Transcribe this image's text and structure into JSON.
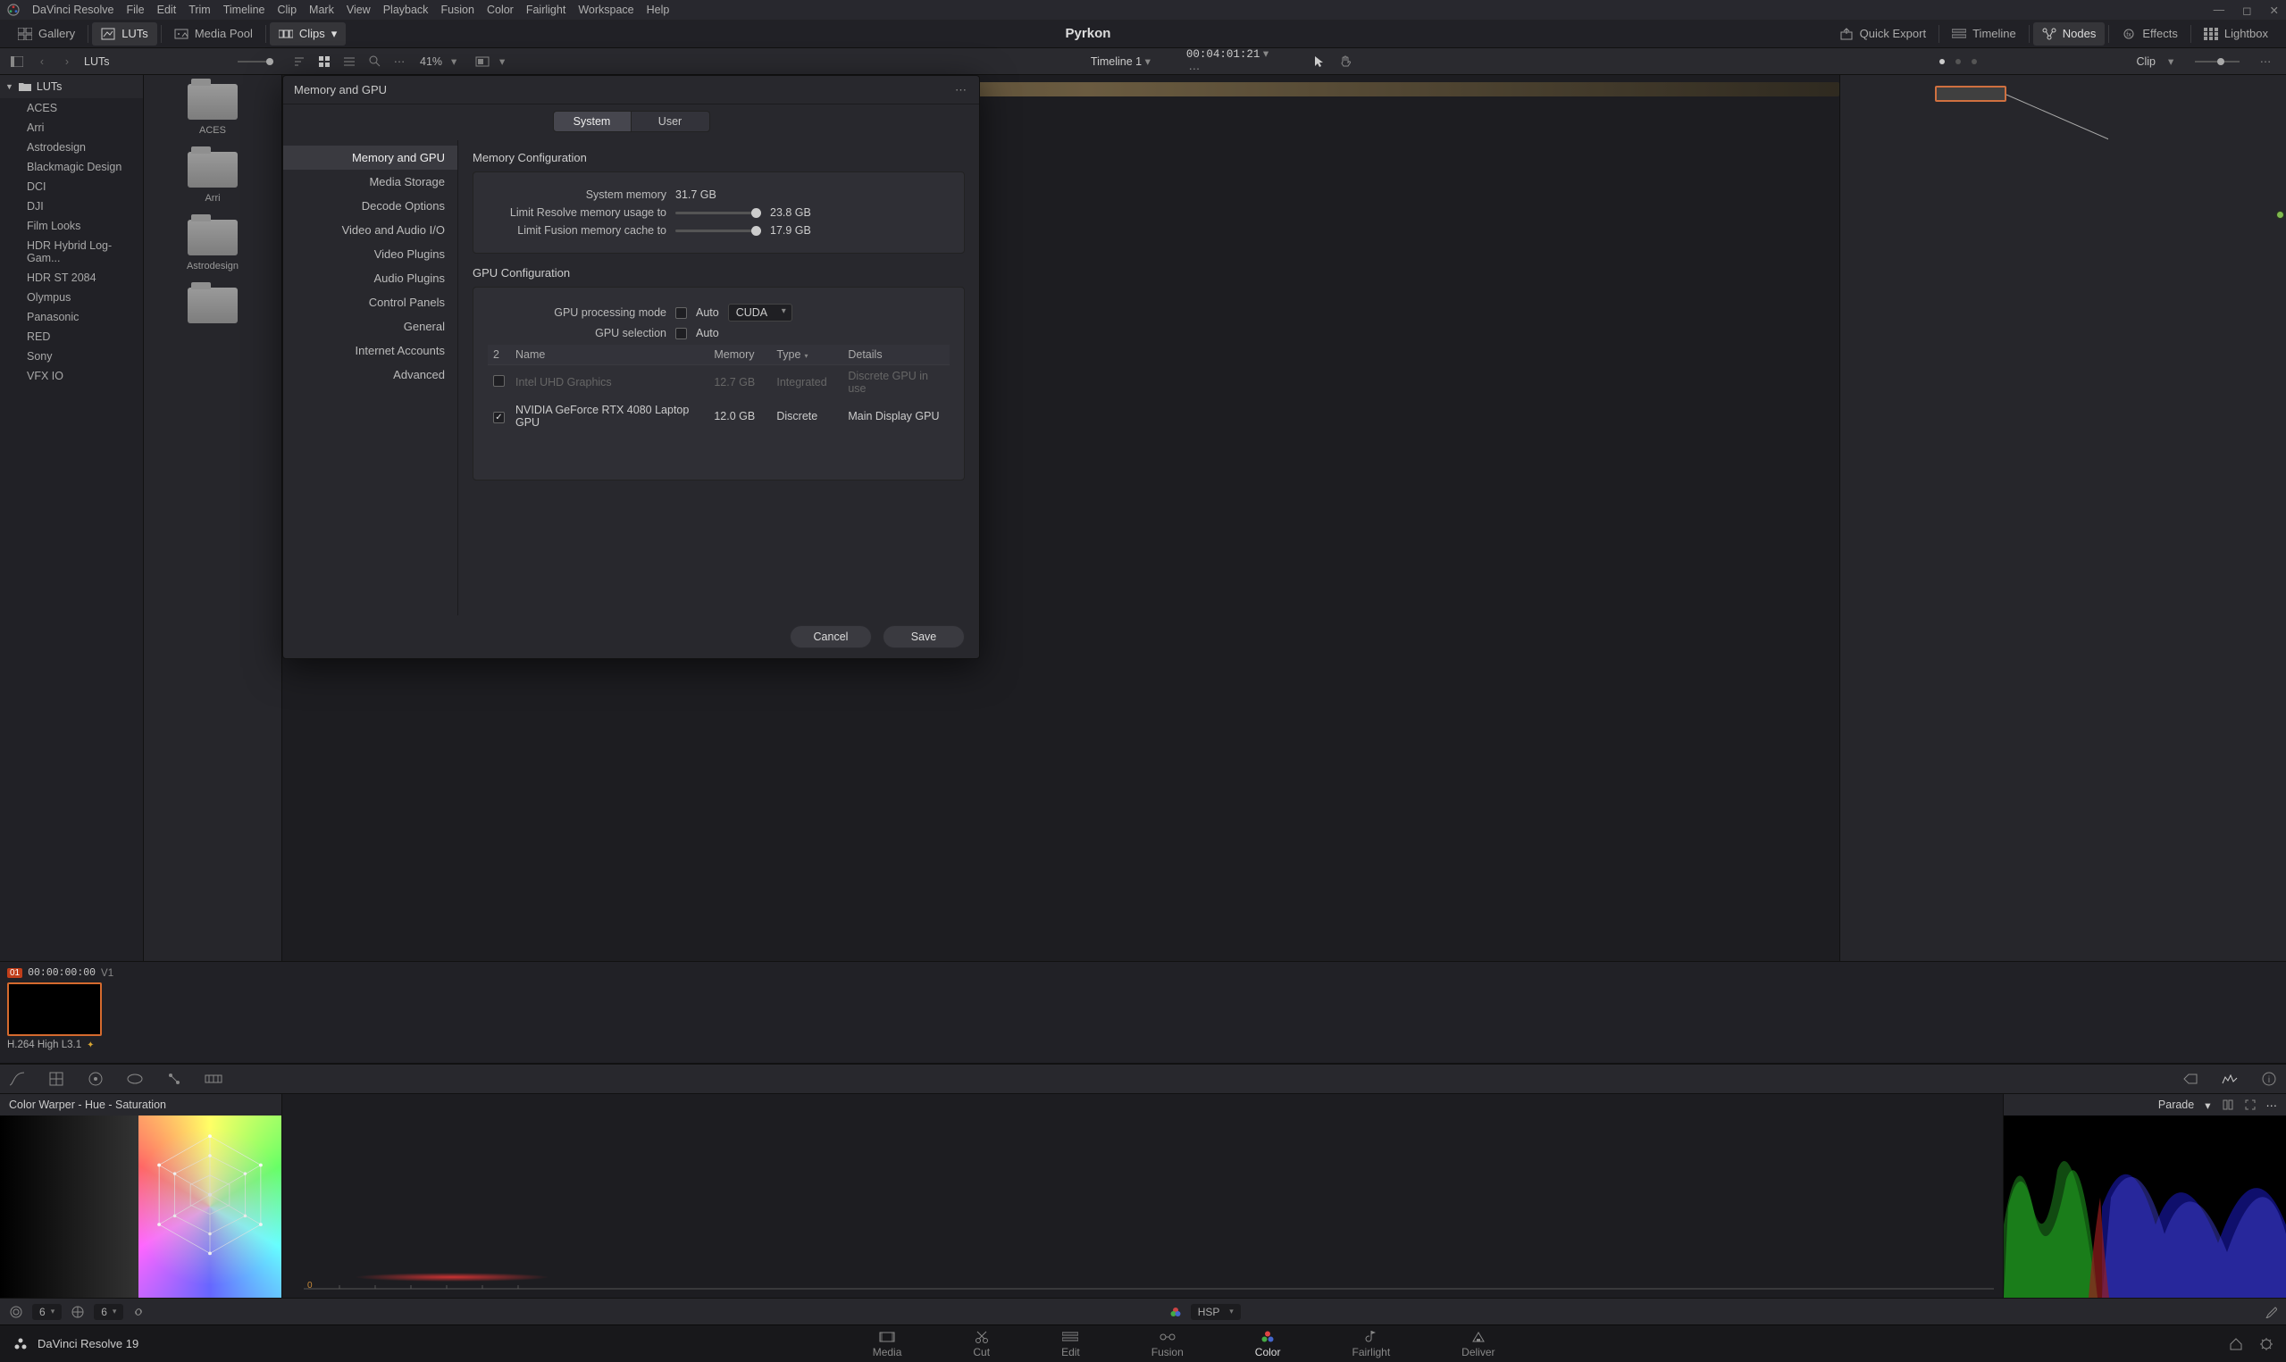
{
  "app_name": "DaVinci Resolve",
  "menus": [
    "File",
    "Edit",
    "Trim",
    "Timeline",
    "Clip",
    "Mark",
    "View",
    "Playback",
    "Fusion",
    "Color",
    "Fairlight",
    "Workspace",
    "Help"
  ],
  "project_title": "Pyrkon",
  "toolbar": {
    "gallery": "Gallery",
    "luts": "LUTs",
    "media_pool": "Media Pool",
    "clips": "Clips",
    "quick_export": "Quick Export",
    "timeline": "Timeline",
    "nodes": "Nodes",
    "effects": "Effects",
    "lightbox": "Lightbox"
  },
  "secondbar": {
    "panel_label": "LUTs",
    "zoom": "41%",
    "timeline_name": "Timeline 1",
    "timecode": "00:04:01:21",
    "node_label": "Clip"
  },
  "luts_tree": {
    "root": "LUTs",
    "items": [
      "ACES",
      "Arri",
      "Astrodesign",
      "Blackmagic Design",
      "DCI",
      "DJI",
      "Film Looks",
      "HDR Hybrid Log-Gam...",
      "HDR ST 2084",
      "Olympus",
      "Panasonic",
      "RED",
      "Sony",
      "VFX IO"
    ]
  },
  "folders": [
    "ACES",
    "Arri",
    "Astrodesign"
  ],
  "clip": {
    "num": "01",
    "tc": "00:00:00:00",
    "ver": "V1",
    "codec": "H.264 High L3.1"
  },
  "warper": {
    "title": "Color Warper - Hue - Saturation"
  },
  "scope": {
    "mode": "Parade"
  },
  "optbar": {
    "val1": "6",
    "val2": "6",
    "mode": "HSP"
  },
  "brand": "DaVinci Resolve 19",
  "pages": [
    "Media",
    "Cut",
    "Edit",
    "Fusion",
    "Color",
    "Fairlight",
    "Deliver"
  ],
  "active_page": "Color",
  "dialog": {
    "title": "Memory and GPU",
    "tabs": {
      "system": "System",
      "user": "User"
    },
    "categories": [
      "Memory and GPU",
      "Media Storage",
      "Decode Options",
      "Video and Audio I/O",
      "Video Plugins",
      "Audio Plugins",
      "Control Panels",
      "General",
      "Internet Accounts",
      "Advanced"
    ],
    "active_category": "Memory and GPU",
    "mem": {
      "section": "Memory Configuration",
      "system_memory_label": "System memory",
      "system_memory_value": "31.7 GB",
      "resolve_limit_label": "Limit Resolve memory usage to",
      "resolve_limit_value": "23.8 GB",
      "fusion_limit_label": "Limit Fusion memory cache to",
      "fusion_limit_value": "17.9 GB"
    },
    "gpu": {
      "section": "GPU Configuration",
      "mode_label": "GPU processing mode",
      "auto_label": "Auto",
      "mode_value": "CUDA",
      "selection_label": "GPU selection",
      "table": {
        "count": "2",
        "headers": {
          "name": "Name",
          "memory": "Memory",
          "type": "Type",
          "details": "Details"
        },
        "rows": [
          {
            "checked": false,
            "disabled": true,
            "name": "Intel UHD Graphics",
            "memory": "12.7 GB",
            "type": "Integrated",
            "details": "Discrete GPU in use"
          },
          {
            "checked": true,
            "disabled": false,
            "name": "NVIDIA GeForce RTX 4080 Laptop GPU",
            "memory": "12.0 GB",
            "type": "Discrete",
            "details": "Main Display GPU"
          }
        ]
      }
    },
    "buttons": {
      "cancel": "Cancel",
      "save": "Save"
    }
  }
}
